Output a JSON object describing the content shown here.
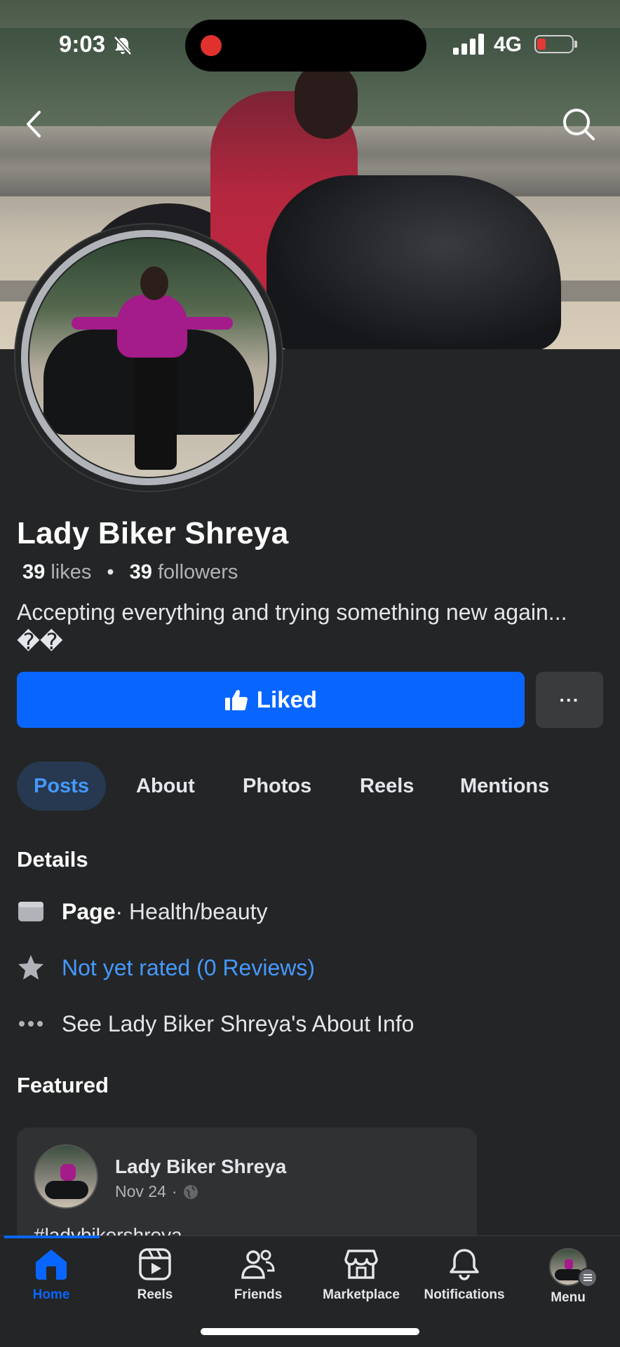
{
  "status_bar": {
    "time": "9:03",
    "network": "4G"
  },
  "profile": {
    "name": "Lady Biker Shreya",
    "likes_count": "39",
    "likes_label": "likes",
    "followers_count": "39",
    "followers_label": "followers",
    "separator": "•",
    "bio": "Accepting everything and trying something new again... ��"
  },
  "actions": {
    "liked_label": "Liked",
    "more_label": "···"
  },
  "tabs": [
    {
      "label": "Posts",
      "active": true
    },
    {
      "label": "About",
      "active": false
    },
    {
      "label": "Photos",
      "active": false
    },
    {
      "label": "Reels",
      "active": false
    },
    {
      "label": "Mentions",
      "active": false
    }
  ],
  "details": {
    "title": "Details",
    "page_label": "Page",
    "page_category": " · Health/beauty",
    "rating": "Not yet rated (0 Reviews)",
    "about_link": "See Lady Biker Shreya's About Info"
  },
  "featured": {
    "title": "Featured",
    "post": {
      "author": "Lady Biker Shreya",
      "date": "Nov 24",
      "date_sep": "·",
      "text": "#ladybikershreya"
    }
  },
  "bottom_nav": [
    {
      "label": "Home",
      "icon": "home-icon",
      "active": true
    },
    {
      "label": "Reels",
      "icon": "reels-icon",
      "active": false
    },
    {
      "label": "Friends",
      "icon": "friends-icon",
      "active": false
    },
    {
      "label": "Marketplace",
      "icon": "marketplace-icon",
      "active": false
    },
    {
      "label": "Notifications",
      "icon": "bell-icon",
      "active": false
    },
    {
      "label": "Menu",
      "icon": "menu-avatar",
      "active": false
    }
  ],
  "colors": {
    "accent": "#0866ff",
    "link": "#4599ff",
    "background": "#242526",
    "battery_low": "#e53935"
  }
}
